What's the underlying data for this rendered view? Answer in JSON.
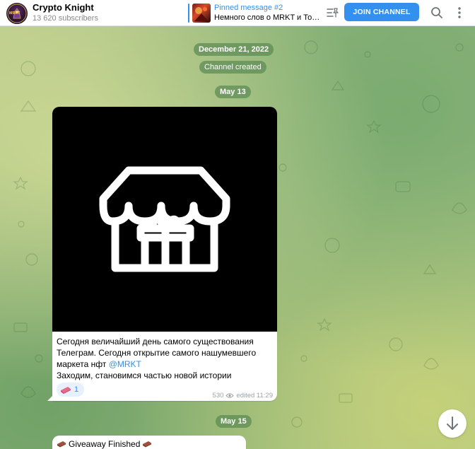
{
  "header": {
    "channel_name": "Crypto Knight",
    "subscribers": "13 620 subscribers",
    "avatar_text": "MRKT",
    "pinned_title": "Pinned message #2",
    "pinned_text": "Немного слов о MRKT и Топ...",
    "join_label": "JOIN CHANNEL"
  },
  "chat": {
    "date_1": "December 21, 2022",
    "system_1": "Channel created",
    "date_2": "May 13",
    "post": {
      "line_1": "Сегодня величайший день самого существования",
      "line_2": "Телеграм. Сегодня открытие самого нашумевшего",
      "line_3_text": "маркета нфт ",
      "line_3_link": "@MRKT",
      "line_4": "Заходим, становимся частью новой истории",
      "reaction_count": "1",
      "views": "530",
      "edited": "edited 11:29"
    },
    "date_3": "May 15",
    "post2": {
      "text": "Giveaway Finished"
    }
  },
  "colors": {
    "accent": "#3390ec",
    "date_pill": "#5e8c54",
    "bubble": "#ffffff"
  }
}
